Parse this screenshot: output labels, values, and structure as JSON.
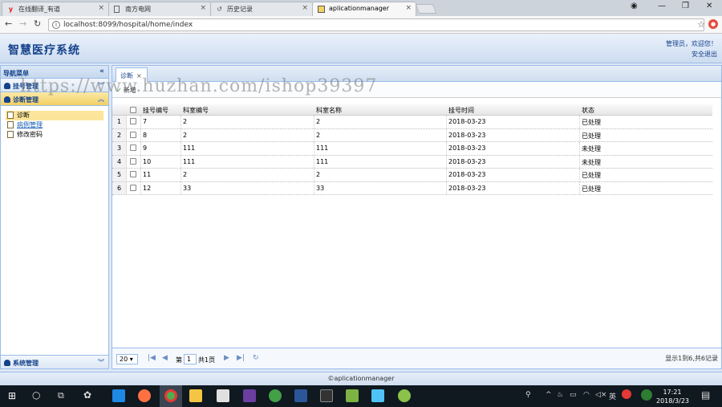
{
  "browser": {
    "tabs": [
      {
        "label": "在线翻译_有道",
        "icon": "youdao-icon",
        "active": false
      },
      {
        "label": "南方电网",
        "icon": "page-icon",
        "active": false
      },
      {
        "label": "历史记录",
        "icon": "history-icon",
        "active": false
      },
      {
        "label": "aplicationmanager",
        "icon": "app-icon",
        "active": true
      }
    ],
    "url": "localhost:8099/hospital/home/index"
  },
  "header": {
    "title": "智慧医疗系统",
    "user_line": "管理员，欢迎您！",
    "logout": "安全退出"
  },
  "sidebar": {
    "title": "导航菜单",
    "sections": [
      {
        "label": "挂号管理"
      },
      {
        "label": "诊断管理"
      }
    ],
    "items": [
      {
        "label": "诊断"
      },
      {
        "label": "病例管理"
      },
      {
        "label": "修改密码"
      }
    ],
    "bottom_section": "系统管理"
  },
  "main": {
    "tab_label": "诊断",
    "toolbar_add": "新增",
    "columns": [
      "挂号编号",
      "科室编号",
      "科室名称",
      "挂号时间",
      "状态"
    ],
    "rows": [
      {
        "n": "1",
        "id": "7",
        "dept_id": "2",
        "dept_name": "2",
        "time": "2018-03-23",
        "status": "已处理"
      },
      {
        "n": "2",
        "id": "8",
        "dept_id": "2",
        "dept_name": "2",
        "time": "2018-03-23",
        "status": "已处理"
      },
      {
        "n": "3",
        "id": "9",
        "dept_id": "111",
        "dept_name": "111",
        "time": "2018-03-23",
        "status": "未处理"
      },
      {
        "n": "4",
        "id": "10",
        "dept_id": "111",
        "dept_name": "111",
        "time": "2018-03-23",
        "status": "未处理"
      },
      {
        "n": "5",
        "id": "11",
        "dept_id": "2",
        "dept_name": "2",
        "time": "2018-03-23",
        "status": "已处理"
      },
      {
        "n": "6",
        "id": "12",
        "dept_id": "33",
        "dept_name": "33",
        "time": "2018-03-23",
        "status": "已处理"
      }
    ],
    "pager": {
      "page_size": "20",
      "page_prefix": "第",
      "page_value": "1",
      "page_suffix": "共1页",
      "info": "显示1到6,共6记录"
    }
  },
  "footer": "©aplicationmanager",
  "watermark": "https://www.huzhan.com/ishop39397",
  "taskbar": {
    "time": "17:21",
    "date": "2018/3/23",
    "ime": "英"
  }
}
